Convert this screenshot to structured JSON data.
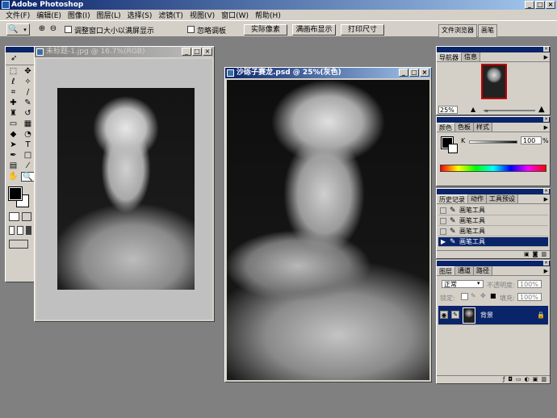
{
  "app": {
    "title": "Adobe Photoshop"
  },
  "menu": [
    "文件(F)",
    "编辑(E)",
    "图像(I)",
    "图层(L)",
    "选择(S)",
    "滤镜(T)",
    "视图(V)",
    "窗口(W)",
    "帮助(H)"
  ],
  "options": {
    "resize_window_label": "调整窗口大小以满屏显示",
    "ignore_palettes_label": "忽略调板",
    "actual_pixels": "实际像素",
    "fit_screen": "满画布显示",
    "print_size": "打印尺寸"
  },
  "palette_well": [
    "文件浏览器",
    "画笔"
  ],
  "doc1": {
    "title": "未标题-1.jpg @ 16.7%(RGB)"
  },
  "doc2": {
    "title": "沙砾子赛龙.psd @ 25%(灰色)"
  },
  "navigator": {
    "tabs": [
      "导航器",
      "信息"
    ],
    "zoom": "25%"
  },
  "color": {
    "tabs": [
      "颜色",
      "色板",
      "样式"
    ],
    "channel": "K",
    "value": "100",
    "unit": "%"
  },
  "history": {
    "tabs": [
      "历史记录",
      "动作",
      "工具预设"
    ],
    "items": [
      "画笔工具",
      "画笔工具",
      "画笔工具",
      "画笔工具"
    ]
  },
  "layers": {
    "tabs": [
      "图层",
      "通道",
      "路径"
    ],
    "blend_mode": "正常",
    "opacity_label": "不透明度:",
    "opacity": "100%",
    "lock_label": "锁定:",
    "fill_label": "填充:",
    "fill": "100%",
    "layer_name": "背景"
  },
  "colors": {
    "titlebar": "#0a246a",
    "chrome": "#d4d0c8",
    "desktop": "#808080",
    "nav_frame": "#c00000"
  }
}
